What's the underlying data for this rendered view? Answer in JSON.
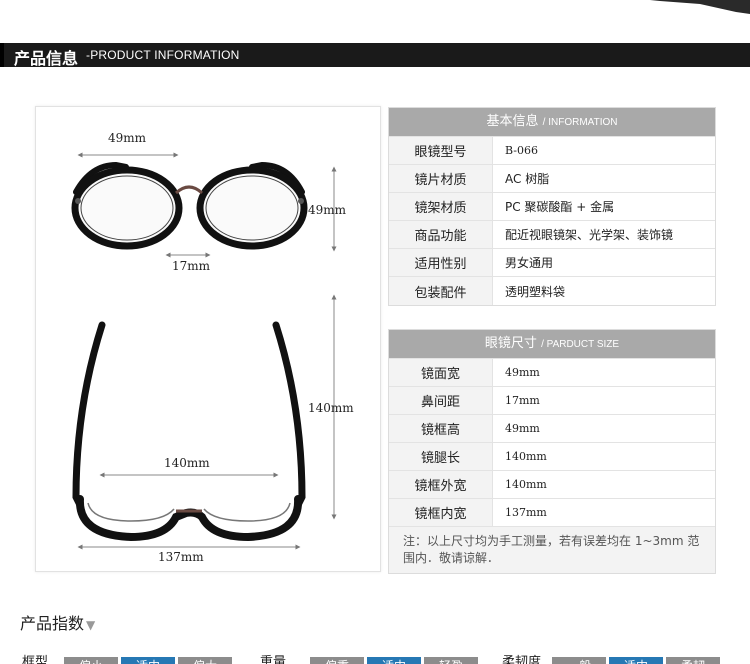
{
  "header": {
    "title_cn": "产品信息",
    "title_en": "-PRODUCT INFORMATION"
  },
  "diagram": {
    "front_width": "49mm",
    "lens_height": "49mm",
    "bridge": "17mm",
    "temple_length": "140mm",
    "inner_width": "140mm",
    "frame_width": "137mm"
  },
  "basic_info": {
    "title": "基本信息",
    "title_en": "/ INFORMATION",
    "rows": [
      {
        "label": "眼镜型号",
        "value": "B-066"
      },
      {
        "label": "镜片材质",
        "value": "AC 树脂"
      },
      {
        "label": "镜架材质",
        "value": "PC 聚碳酸酯 + 金属"
      },
      {
        "label": "商品功能",
        "value": "配近视眼镜架、光学架、装饰镜"
      },
      {
        "label": "适用性别",
        "value": "男女通用"
      },
      {
        "label": "包装配件",
        "value": "透明塑料袋"
      }
    ]
  },
  "size_info": {
    "title": "眼镜尺寸",
    "title_en": "/ PARDUCT SIZE",
    "rows": [
      {
        "label": "镜面宽",
        "value": "49mm"
      },
      {
        "label": "鼻间距",
        "value": "17mm"
      },
      {
        "label": "镜框高",
        "value": "49mm"
      },
      {
        "label": "镜腿长",
        "value": "140mm"
      },
      {
        "label": "镜框外宽",
        "value": "140mm"
      },
      {
        "label": "镜框内宽",
        "value": "137mm"
      }
    ],
    "note": "注：以上尺寸均为手工测量，若有误差均在 1~3mm 范围内．敬请谅解．"
  },
  "index": {
    "title": "产品指数",
    "groups": [
      {
        "label": "框型",
        "options": [
          "偏小",
          "适中",
          "偏大"
        ],
        "active": 1
      },
      {
        "label": "重量",
        "options": [
          "偏重",
          "适中",
          "轻盈"
        ],
        "active": 1
      },
      {
        "label": "柔韧度",
        "options": [
          "一般",
          "适中",
          "柔韧"
        ],
        "active": 1
      }
    ]
  },
  "colors": {
    "header_bg": "#1a1a1a",
    "table_header_bg": "#a9a9a9",
    "active_option": "#2678b4"
  }
}
